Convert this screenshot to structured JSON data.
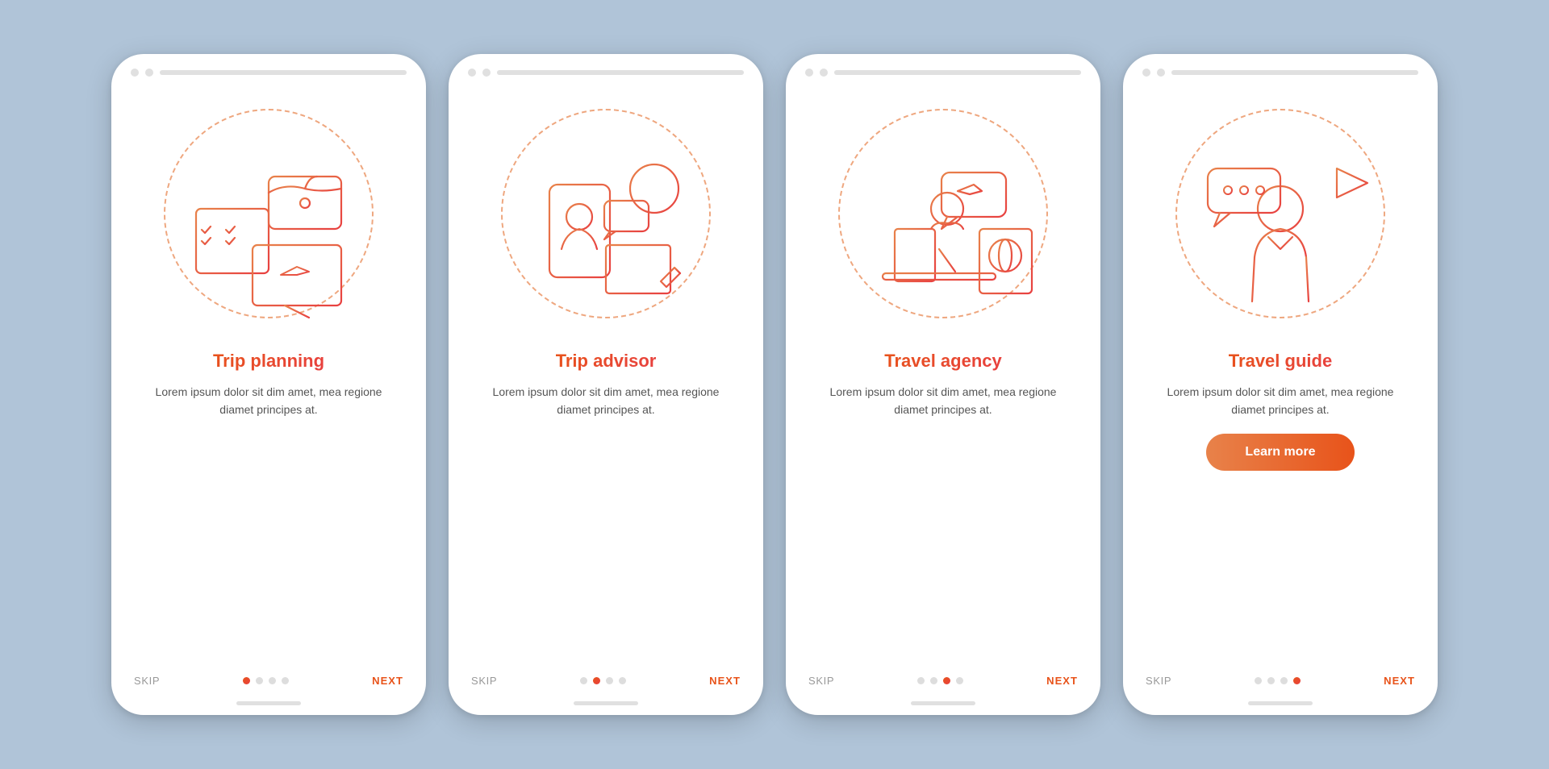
{
  "background": "#b0c4d8",
  "accent_start": "#e8531a",
  "accent_end": "#e84040",
  "cards": [
    {
      "id": "trip-planning",
      "title": "Trip planning",
      "description": "Lorem ipsum dolor sit dim amet, mea regione diamet principes at.",
      "has_learn_more": false,
      "active_dot": 0,
      "dots": [
        true,
        false,
        false,
        false
      ]
    },
    {
      "id": "trip-advisor",
      "title": "Trip advisor",
      "description": "Lorem ipsum dolor sit dim amet, mea regione diamet principes at.",
      "has_learn_more": false,
      "active_dot": 1,
      "dots": [
        false,
        true,
        false,
        false
      ]
    },
    {
      "id": "travel-agency",
      "title": "Travel agency",
      "description": "Lorem ipsum dolor sit dim amet, mea regione diamet principes at.",
      "has_learn_more": false,
      "active_dot": 2,
      "dots": [
        false,
        false,
        true,
        false
      ]
    },
    {
      "id": "travel-guide",
      "title": "Travel guide",
      "description": "Lorem ipsum dolor sit dim amet, mea regione diamet principes at.",
      "has_learn_more": true,
      "learn_more_label": "Learn more",
      "active_dot": 3,
      "dots": [
        false,
        false,
        false,
        true
      ]
    }
  ],
  "nav": {
    "skip": "SKIP",
    "next": "NEXT"
  }
}
